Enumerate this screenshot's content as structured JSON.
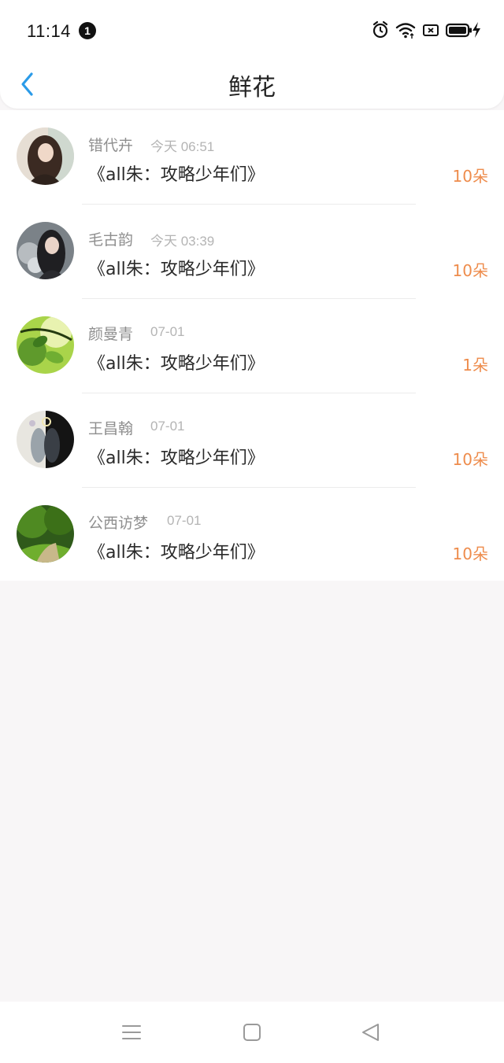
{
  "status_bar": {
    "time": "11:14",
    "notification_count": "1",
    "icons": [
      "alarm-icon",
      "wifi-icon",
      "sim-icon",
      "battery-icon",
      "charging-icon"
    ]
  },
  "header": {
    "title": "鲜花",
    "back_icon": "chevron-left-icon",
    "accent_color": "#2b9be8"
  },
  "items": [
    {
      "username": "错代卉",
      "date": "今天 06:51",
      "title": "《all朱：攻略少年们》",
      "count": "10朵"
    },
    {
      "username": "毛古韵",
      "date": "今天 03:39",
      "title": "《all朱：攻略少年们》",
      "count": "10朵"
    },
    {
      "username": "颜曼青",
      "date": "07-01",
      "title": "《all朱：攻略少年们》",
      "count": "1朵"
    },
    {
      "username": "王昌翰",
      "date": "07-01",
      "title": "《all朱：攻略少年们》",
      "count": "10朵"
    },
    {
      "username": "公西访梦",
      "date": "07-01",
      "title": "《all朱：攻略少年们》",
      "count": "10朵"
    }
  ],
  "colors": {
    "count": "#ee8c4c",
    "username": "#8f8f8f",
    "date": "#b4b4b4",
    "page_background": "#f8f6f7"
  },
  "bottom_nav": {
    "icons": [
      "menu-icon",
      "home-icon",
      "back-triangle-icon"
    ]
  }
}
